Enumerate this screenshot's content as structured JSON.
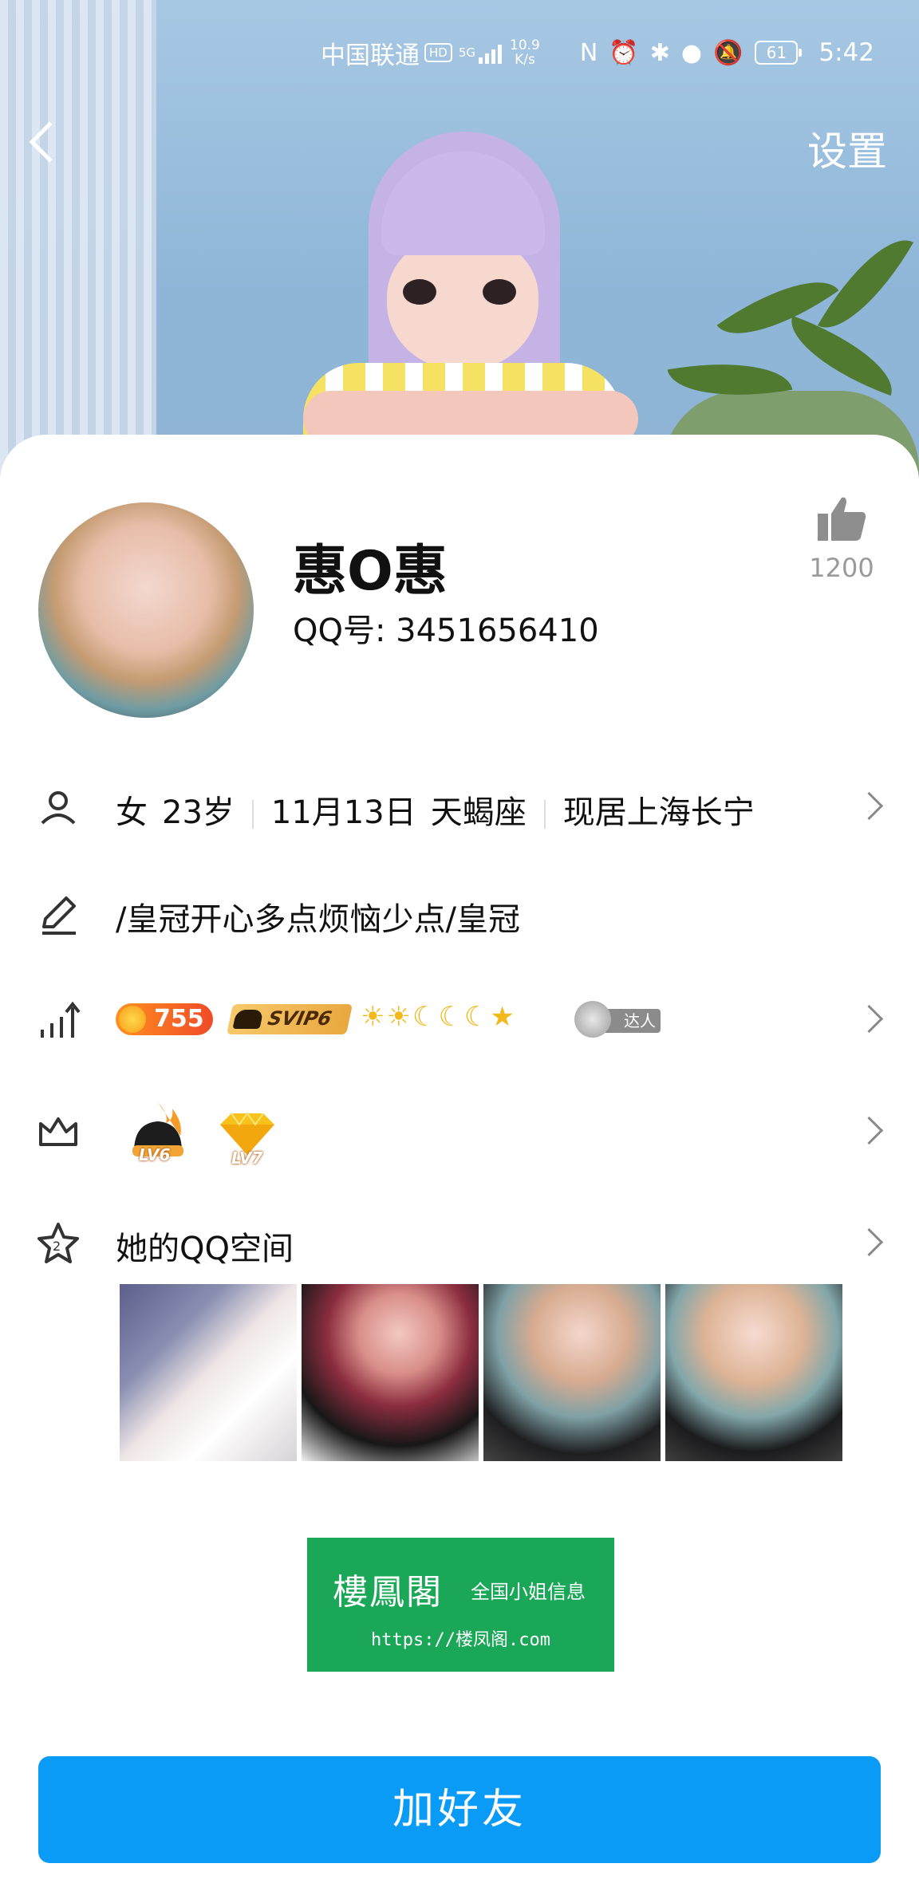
{
  "status_bar": {
    "carrier": "中国联通",
    "hd": "HD",
    "network": "5G",
    "speed_value": "10.9",
    "speed_unit": "K/s",
    "battery": "61",
    "time": "5:42"
  },
  "header": {
    "settings_label": "设置"
  },
  "profile": {
    "name": "惠O惠",
    "qq_label": "QQ号: 3451656410",
    "likes": "1200"
  },
  "info": {
    "gender": "女",
    "age": "23岁",
    "birthday": "11月13日",
    "zodiac": "天蝎座",
    "location": "现居上海长宁"
  },
  "signature": "/皇冠开心多点烦恼少点/皇冠",
  "level": {
    "coin_value": "755",
    "svip_label": "SVIP6",
    "level_icons": "☀☀☾☾☾★",
    "daren_label": "达人"
  },
  "privileges": {
    "badge1_level": "LV6",
    "badge2_level": "LV7"
  },
  "qzone": {
    "title": "她的QQ空间"
  },
  "ad": {
    "title": "樓鳳閣",
    "subtitle": "全国小姐信息",
    "url": "https://楼凤阁.com"
  },
  "actions": {
    "add_friend": "加好友"
  },
  "colors": {
    "primary_button": "#0a9bf7",
    "ad_green": "#1aa757"
  }
}
